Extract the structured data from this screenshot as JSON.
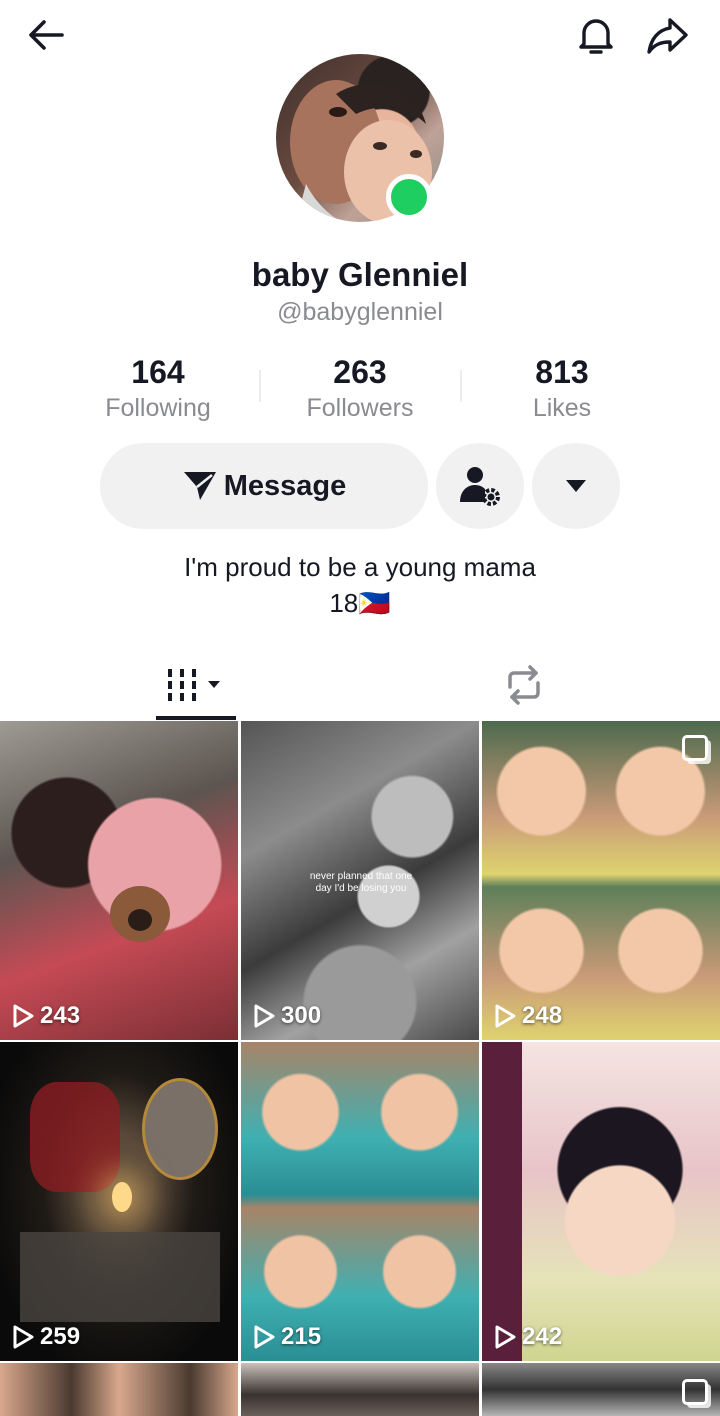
{
  "header": {
    "back_icon": "arrow-left-icon",
    "bell_icon": "bell-icon",
    "share_icon": "share-arrow-icon"
  },
  "profile": {
    "display_name": "baby Glenniel",
    "username": "@babyglenniel",
    "online": true
  },
  "stats": [
    {
      "value": "164",
      "label": "Following"
    },
    {
      "value": "263",
      "label": "Followers"
    },
    {
      "value": "813",
      "label": "Likes"
    }
  ],
  "actions": {
    "message_label": "Message",
    "add_friend_icon": "user-settings-icon",
    "more_icon": "caret-down-icon"
  },
  "bio": {
    "line1": "I'm proud to be a young mama",
    "line2": "18🇵🇭"
  },
  "tabs": [
    {
      "name": "videos",
      "icon": "grid-icon",
      "active": true
    },
    {
      "name": "reposts",
      "icon": "repost-icon",
      "active": false
    }
  ],
  "videos": [
    {
      "views": "243",
      "multi": false
    },
    {
      "views": "300",
      "multi": false,
      "caption": "never planned that one day I'd be losing you"
    },
    {
      "views": "248",
      "multi": true
    },
    {
      "views": "259",
      "multi": false
    },
    {
      "views": "215",
      "multi": false
    },
    {
      "views": "242",
      "multi": false
    },
    {
      "views": "",
      "multi": false
    },
    {
      "views": "",
      "multi": false
    },
    {
      "views": "",
      "multi": true
    }
  ]
}
